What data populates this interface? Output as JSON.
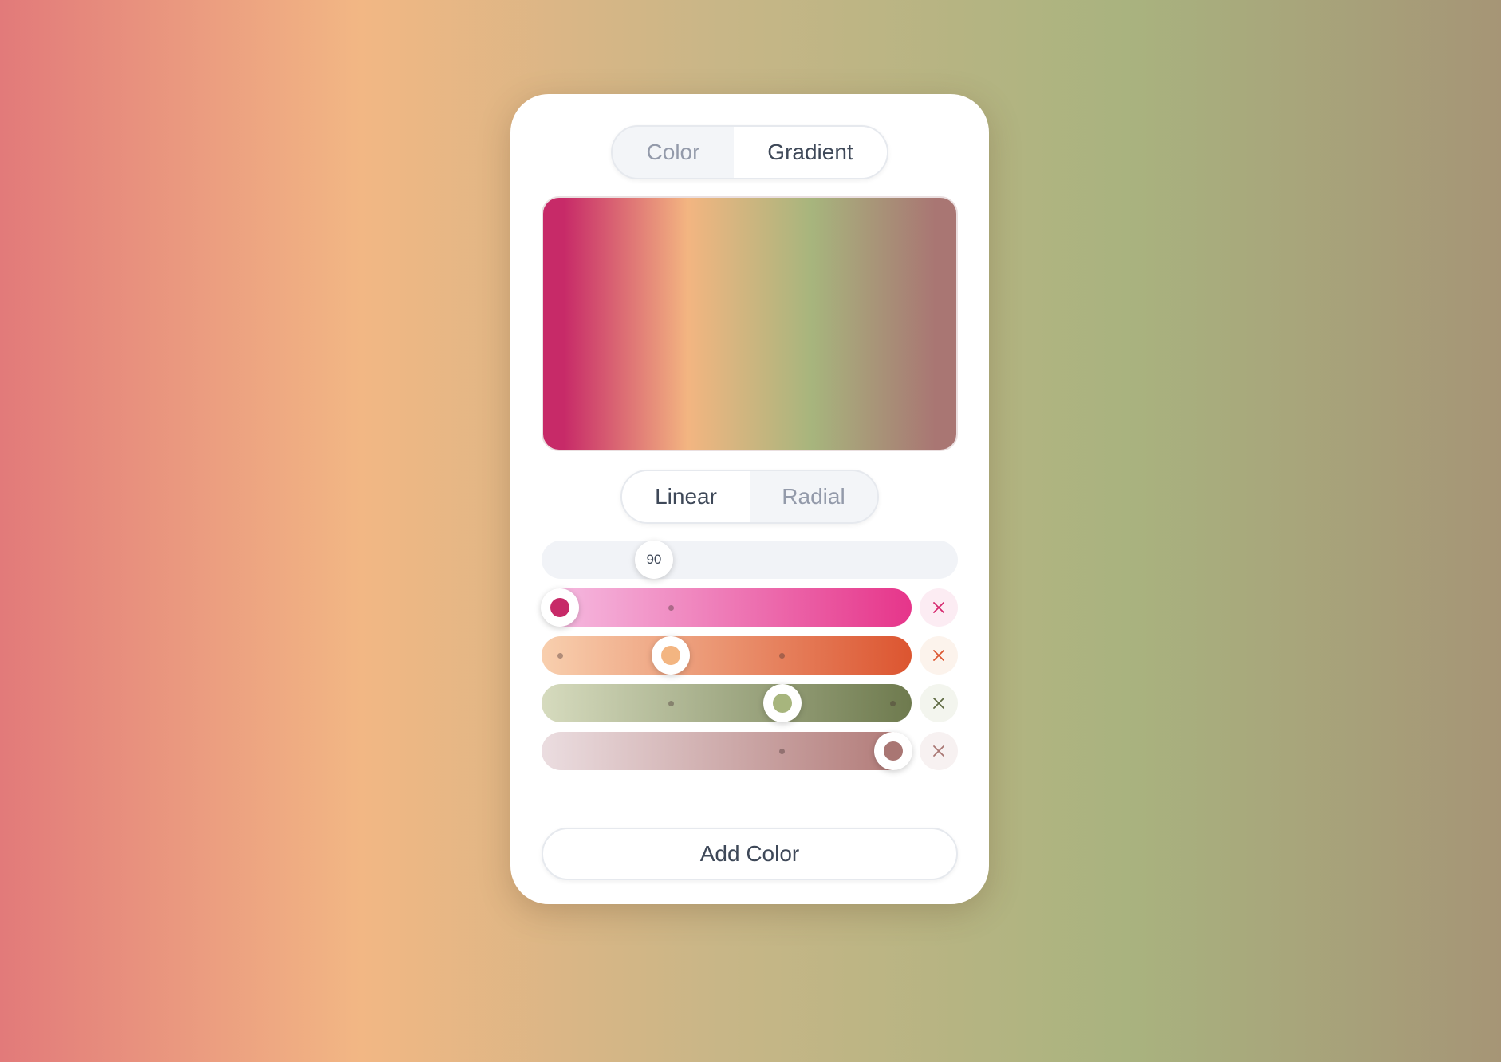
{
  "tabs": {
    "color_label": "Color",
    "gradient_label": "Gradient",
    "active": "gradient"
  },
  "mode": {
    "linear_label": "Linear",
    "radial_label": "Radial",
    "active": "linear"
  },
  "angle": {
    "value": "90",
    "fraction": 0.27
  },
  "stops": [
    {
      "color": "#c72a68",
      "position": 0.05,
      "track": [
        "#f6bfe3",
        "#e6358a"
      ],
      "ticks": [
        0.35
      ],
      "remove_bg": "#fcecf3",
      "remove_color": "#d6286e"
    },
    {
      "color": "#f3b581",
      "position": 0.35,
      "track": [
        "#f8cfae",
        "#dc5530"
      ],
      "ticks": [
        0.05,
        0.65
      ],
      "remove_bg": "#fcf3ec",
      "remove_color": "#dc5530"
    },
    {
      "color": "#a7b57d",
      "position": 0.65,
      "track": [
        "#d6dbbe",
        "#6e7a4e"
      ],
      "ticks": [
        0.35,
        0.95
      ],
      "remove_bg": "#f3f5ee",
      "remove_color": "#5f6a43"
    },
    {
      "color": "#a97673",
      "position": 0.95,
      "track": [
        "#ebdde0",
        "#b07875"
      ],
      "ticks": [
        0.65
      ],
      "remove_bg": "#f7f1f1",
      "remove_color": "#a97673"
    }
  ],
  "add_label": "Add Color"
}
